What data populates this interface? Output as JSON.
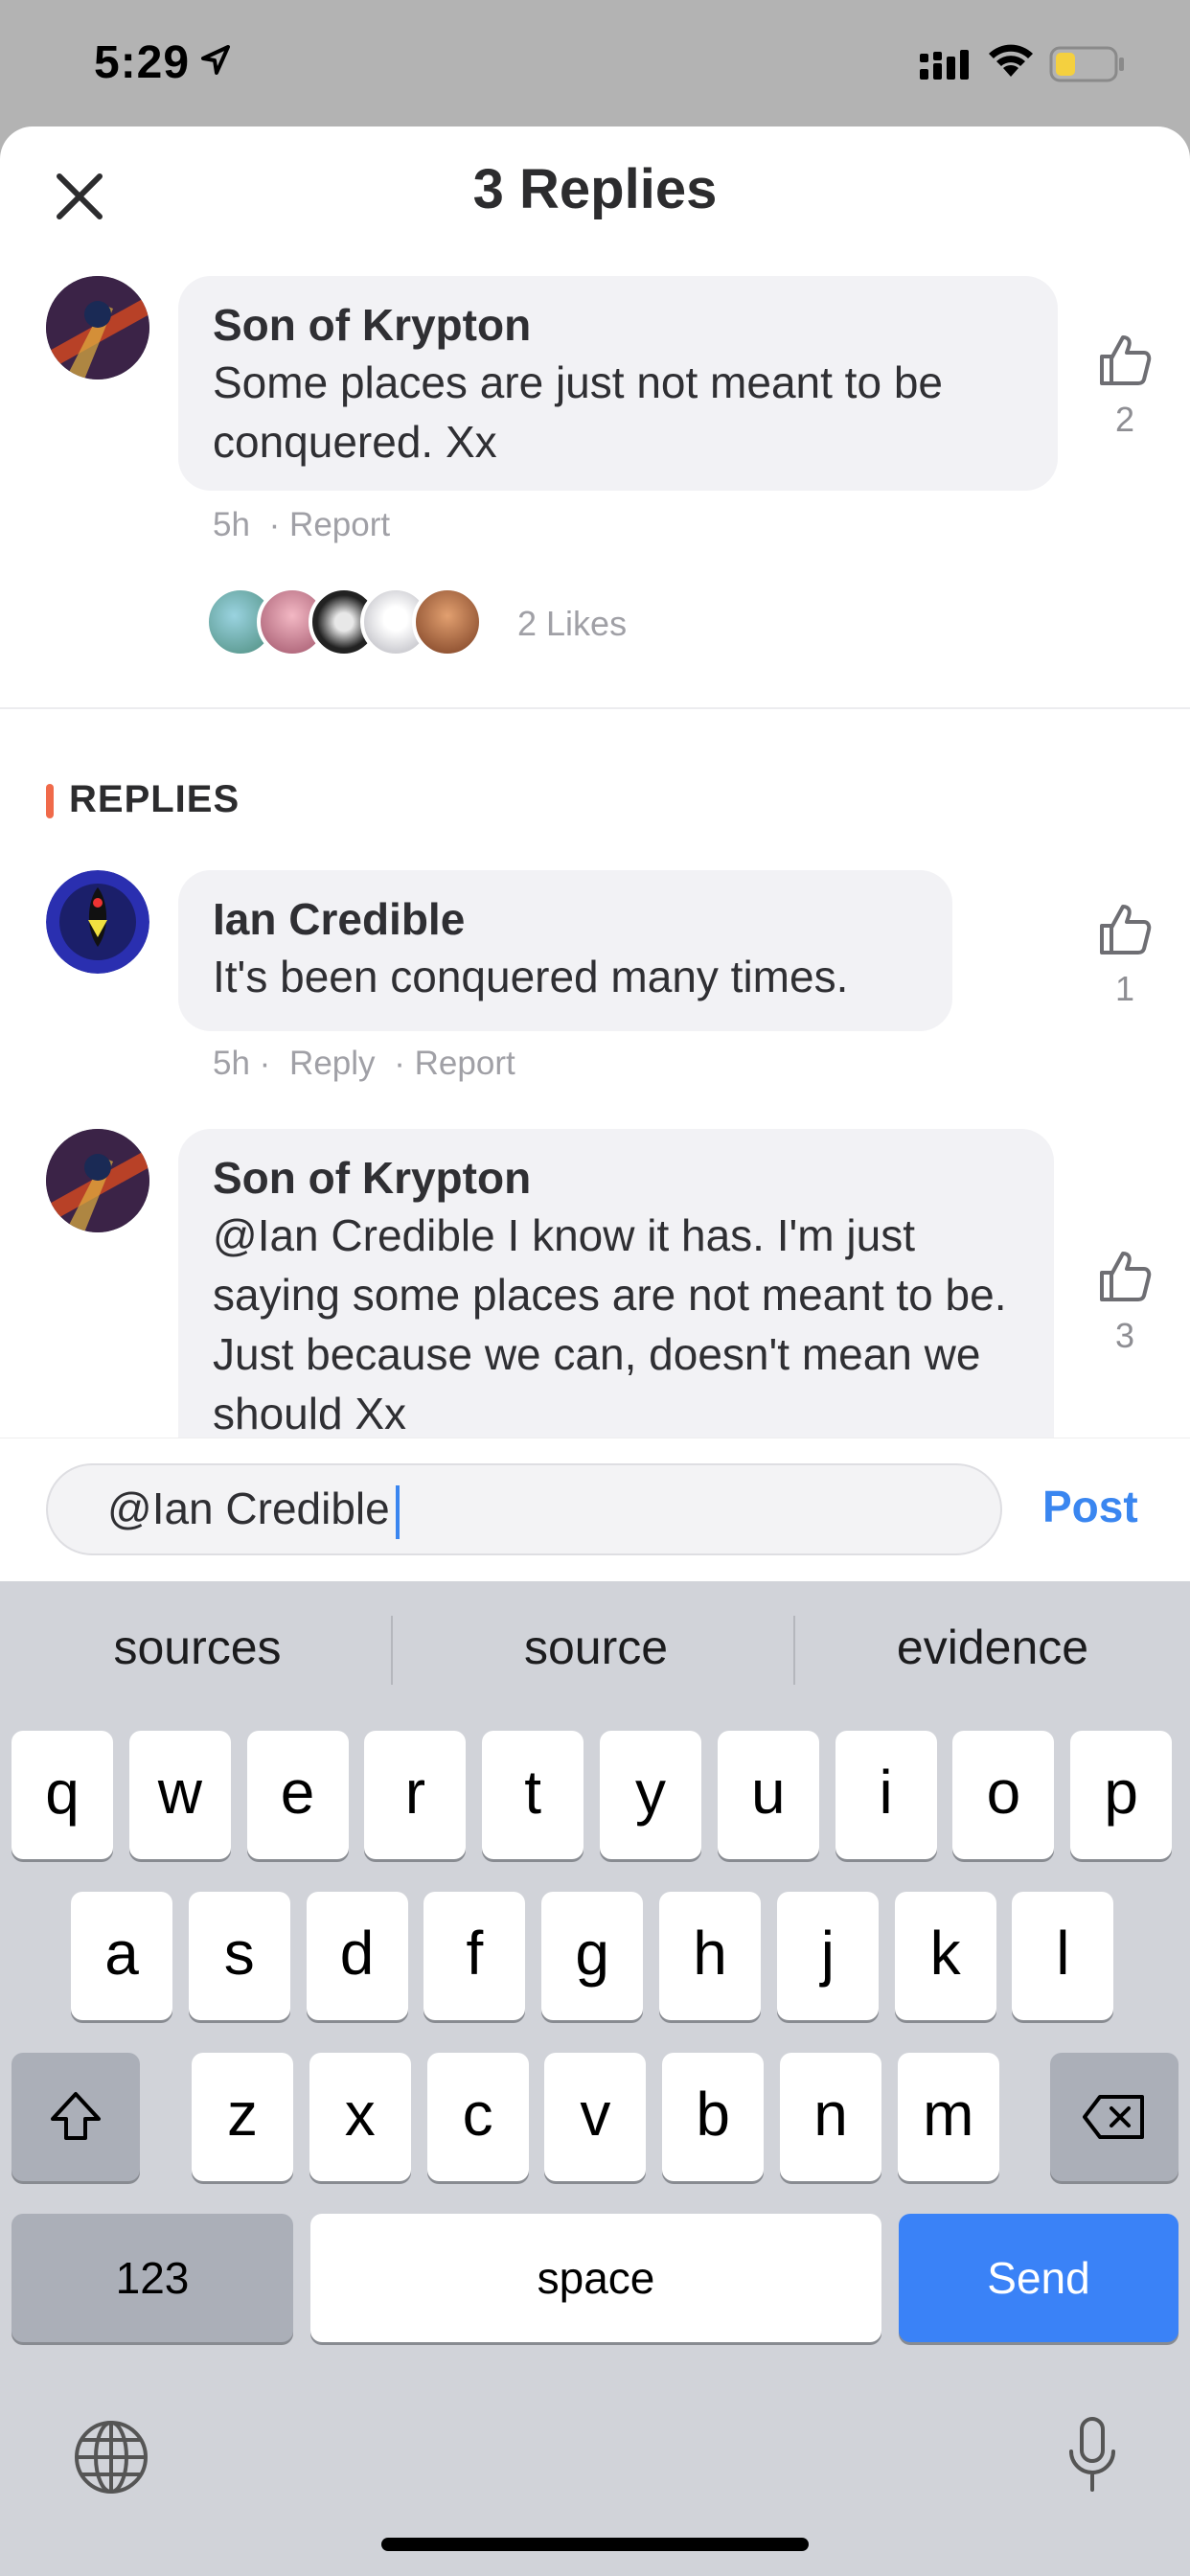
{
  "status_bar": {
    "time": "5:29",
    "battery_color": "#f4d03f"
  },
  "header": {
    "title": "3 Replies"
  },
  "comment": {
    "author": "Son of Krypton",
    "text": "Some places are just not meant to be conquered. Xx",
    "time": "5h",
    "report_label": "· Report",
    "like_count": "2",
    "likes_label": "2 Likes"
  },
  "replies_section": {
    "heading": "REPLIES"
  },
  "replies": [
    {
      "author": "Ian Credible",
      "text": "It's been conquered many times.",
      "time": "5h ·",
      "reply_label": "Reply",
      "report_label": "· Report",
      "like_count": "1"
    },
    {
      "author": "Son of Krypton",
      "text": "@Ian Credible I know it has. I'm just saying some places are not meant to be. Just because we can, doesn't mean we should Xx",
      "like_count": "3"
    }
  ],
  "composer": {
    "value": "@Ian Credible",
    "post_label": "Post"
  },
  "keyboard": {
    "suggestions": [
      "sources",
      "source",
      "evidence"
    ],
    "row1": [
      "q",
      "w",
      "e",
      "r",
      "t",
      "y",
      "u",
      "i",
      "o",
      "p"
    ],
    "row2": [
      "a",
      "s",
      "d",
      "f",
      "g",
      "h",
      "j",
      "k",
      "l"
    ],
    "row3": [
      "z",
      "x",
      "c",
      "v",
      "b",
      "n",
      "m"
    ],
    "numbers_label": "123",
    "space_label": "space",
    "send_label": "Send"
  },
  "colors": {
    "accent": "#3a86f0",
    "replies_marker": "#f06a4a",
    "send_key": "#3a82f7"
  }
}
